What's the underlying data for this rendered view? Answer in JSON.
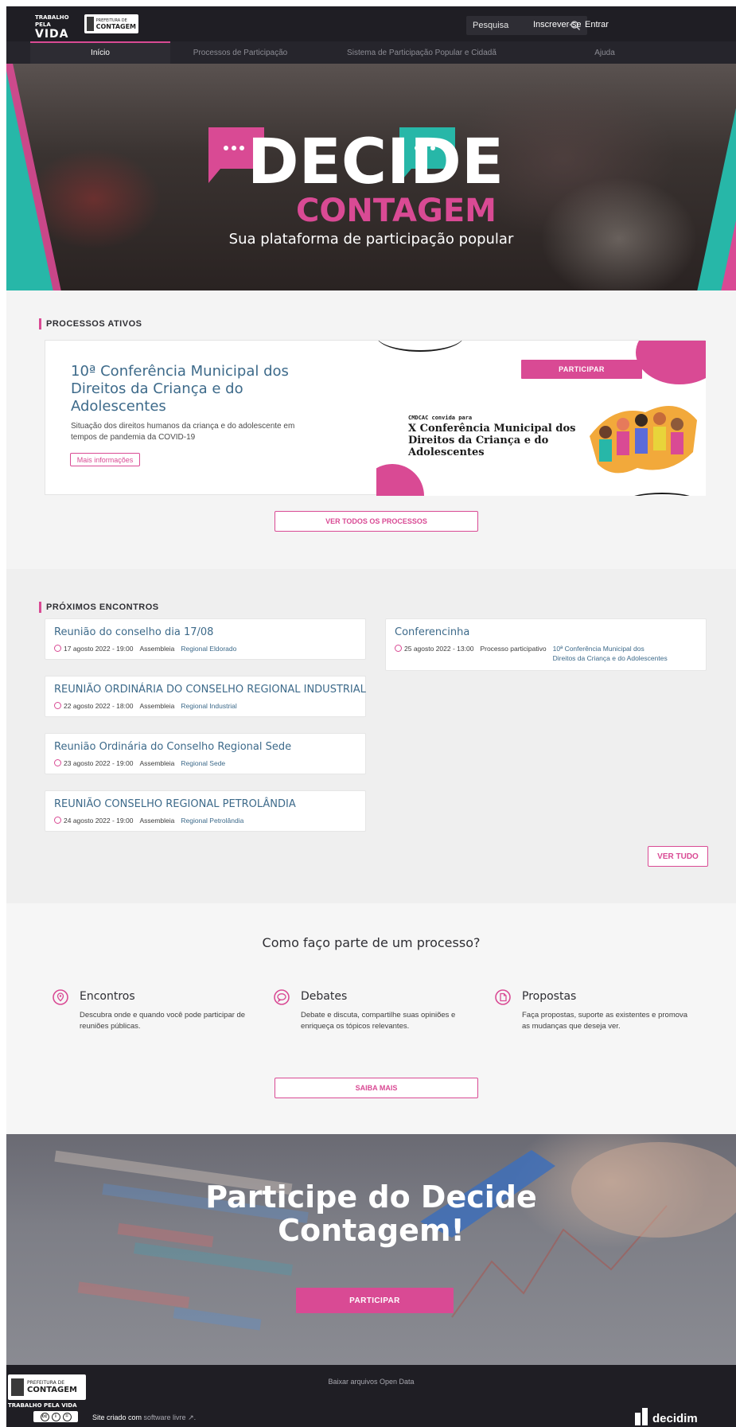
{
  "header": {
    "logo_vida": "TRABALHO PELA VIDA",
    "logo_prefeitura": "PREFEITURA DE CONTAGEM",
    "search_placeholder": "Pesquisa",
    "signup": "Inscrever-se",
    "login": "Entrar"
  },
  "nav": {
    "items": [
      {
        "label": "Início",
        "active": true
      },
      {
        "label": "Processos de Participação",
        "active": false
      },
      {
        "label": "Sistema de Participação Popular e Cidadã",
        "active": false
      },
      {
        "label": "Ajuda",
        "active": false
      }
    ]
  },
  "hero": {
    "logo_line1": "DECIDE",
    "logo_line2": "CONTAGEM",
    "tagline": "Sua plataforma de participação popular",
    "colors": {
      "pink": "#d94a94",
      "teal": "#27b7a8"
    }
  },
  "processes": {
    "section_title": "PROCESSOS ATIVOS",
    "card": {
      "title": "10ª Conferência Municipal dos Direitos da Criança e do Adolescentes",
      "description": "Situação dos direitos humanos da criança e do adolescente em tempos de pandemia da COVID-19",
      "more_info": "Mais informações",
      "participate": "PARTICIPAR",
      "image_small": "CMDCAC convida para",
      "image_title": "X Conferência Municipal dos Direitos da Criança e do Adolescentes"
    },
    "see_all": "VER TODOS OS PROCESSOS"
  },
  "meetings": {
    "section_title": "PRÓXIMOS ENCONTROS",
    "left": [
      {
        "title": "Reunião do conselho dia 17/08",
        "date": "17 agosto 2022",
        "time": "19:00",
        "type": "Assembleia",
        "scope": "Regional Eldorado"
      },
      {
        "title": "REUNIÃO ORDINÁRIA DO CONSELHO REGIONAL INDUSTRIAL",
        "date": "22 agosto 2022",
        "time": "18:00",
        "type": "Assembleia",
        "scope": "Regional Industrial"
      },
      {
        "title": "Reunião Ordinária do Conselho Regional Sede",
        "date": "23 agosto 2022",
        "time": "19:00",
        "type": "Assembleia",
        "scope": "Regional Sede"
      },
      {
        "title": "REUNIÃO CONSELHO REGIONAL PETROLÂNDIA",
        "date": "24 agosto 2022",
        "time": "19:00",
        "type": "Assembleia",
        "scope": "Regional Petrolândia"
      }
    ],
    "right": [
      {
        "title": "Conferencinha",
        "date": "25 agosto 2022",
        "time": "13:00",
        "type": "Processo participativo",
        "scope_line1": "10ª Conferência Municipal dos",
        "scope_line2": "Direitos da Criança e do Adolescentes"
      }
    ],
    "see_all": "VER TUDO"
  },
  "how": {
    "title": "Como faço parte de um processo?",
    "steps": [
      {
        "icon": "location-pin-icon",
        "title": "Encontros",
        "text": "Descubra onde e quando você pode participar de reuniões públicas."
      },
      {
        "icon": "chat-bubble-icon",
        "title": "Debates",
        "text": "Debate e discuta, compartilhe suas opiniões e enriqueça os tópicos relevantes."
      },
      {
        "icon": "document-icon",
        "title": "Propostas",
        "text": "Faça propostas, suporte as existentes e promova as mudanças que deseja ver."
      }
    ],
    "learn_more": "SAIBA MAIS"
  },
  "cta": {
    "title_line1": "Participe do Decide",
    "title_line2": "Contagem!",
    "button": "PARTICIPAR"
  },
  "footer": {
    "logo_prefeitura": "PREFEITURA DE CONTAGEM",
    "logo_vida": "TRABALHO PELA VIDA",
    "open_data": "Baixar arquivos Open Data",
    "created_prefix": "Site criado com",
    "created_link": "software livre",
    "decidim": "decidim"
  }
}
